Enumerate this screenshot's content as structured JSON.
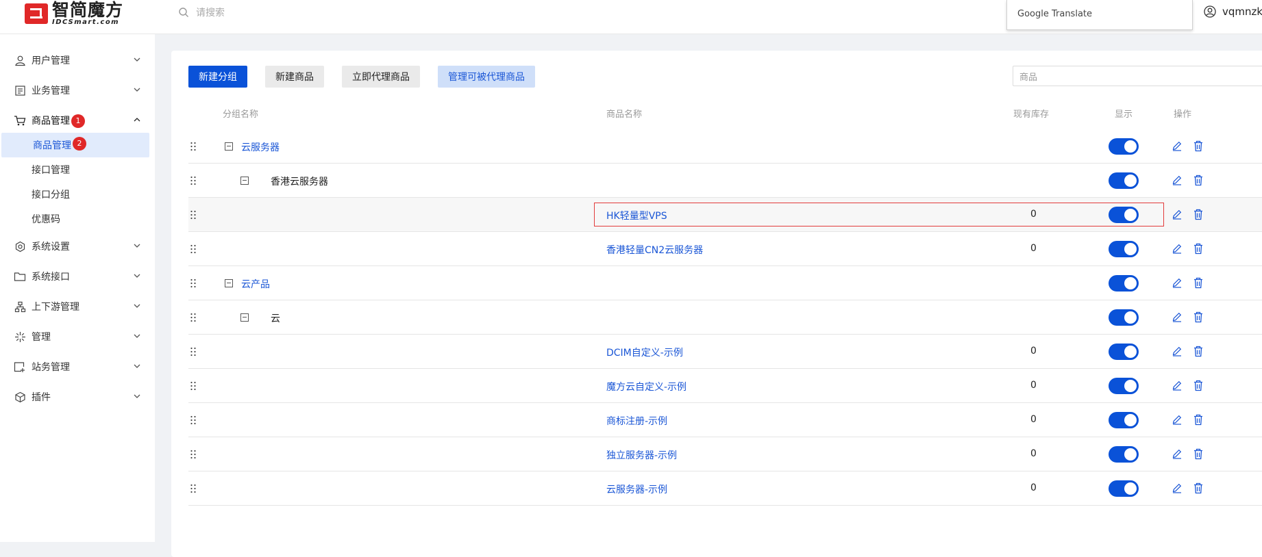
{
  "header": {
    "logo_cn": "智简魔方",
    "logo_en": "IDCSmart.com",
    "search_placeholder": "请搜索",
    "google_translate": "Google Translate",
    "username": "vqmnzki"
  },
  "sidebar": {
    "menu": [
      {
        "label": "用户管理",
        "icon": "user-icon"
      },
      {
        "label": "业务管理",
        "icon": "list-icon"
      },
      {
        "label": "商品管理",
        "icon": "cart-icon",
        "badge": "1"
      },
      {
        "label": "系统设置",
        "icon": "settings-icon"
      },
      {
        "label": "系统接口",
        "icon": "folder-icon"
      },
      {
        "label": "上下游管理",
        "icon": "network-icon"
      },
      {
        "label": "管理",
        "icon": "sparkle-icon"
      },
      {
        "label": "站务管理",
        "icon": "site-icon"
      },
      {
        "label": "插件",
        "icon": "cube-icon"
      }
    ],
    "submenu": [
      {
        "label": "商品管理",
        "badge": "2",
        "active": true
      },
      {
        "label": "接口管理"
      },
      {
        "label": "接口分组"
      },
      {
        "label": "优惠码"
      }
    ]
  },
  "toolbar": {
    "new_group": "新建分组",
    "new_product": "新建商品",
    "proxy_now": "立即代理商品",
    "manage_proxy": "管理可被代理商品",
    "filter_placeholder": "商品"
  },
  "table": {
    "headers": {
      "group": "分组名称",
      "product": "商品名称",
      "stock": "现有库存",
      "display": "显示",
      "actions": "操作"
    },
    "rows": [
      {
        "group": "云服务器",
        "level": 1,
        "product": "",
        "stock": "",
        "shown": true
      },
      {
        "group": "香港云服务器",
        "level": 2,
        "product": "",
        "stock": "",
        "shown": true
      },
      {
        "group": "",
        "level": 0,
        "product": "HK轻量型VPS",
        "stock": "0",
        "shown": true
      },
      {
        "group": "",
        "level": 0,
        "product": "香港轻量CN2云服务器",
        "stock": "0",
        "shown": true
      },
      {
        "group": "云产品",
        "level": 1,
        "product": "",
        "stock": "",
        "shown": true
      },
      {
        "group": "云",
        "level": 2,
        "product": "",
        "stock": "",
        "shown": true
      },
      {
        "group": "",
        "level": 0,
        "product": "DCIM自定义-示例",
        "stock": "0",
        "shown": true
      },
      {
        "group": "",
        "level": 0,
        "product": "魔方云自定义-示例",
        "stock": "0",
        "shown": true
      },
      {
        "group": "",
        "level": 0,
        "product": "商标注册-示例",
        "stock": "0",
        "shown": true
      },
      {
        "group": "",
        "level": 0,
        "product": "独立服务器-示例",
        "stock": "0",
        "shown": true
      },
      {
        "group": "",
        "level": 0,
        "product": "云服务器-示例",
        "stock": "0",
        "shown": true
      }
    ]
  },
  "colors": {
    "primary": "#0a52d8",
    "link": "#1a56d6",
    "badge": "#e02828",
    "highlight_border": "#e23a3a"
  }
}
